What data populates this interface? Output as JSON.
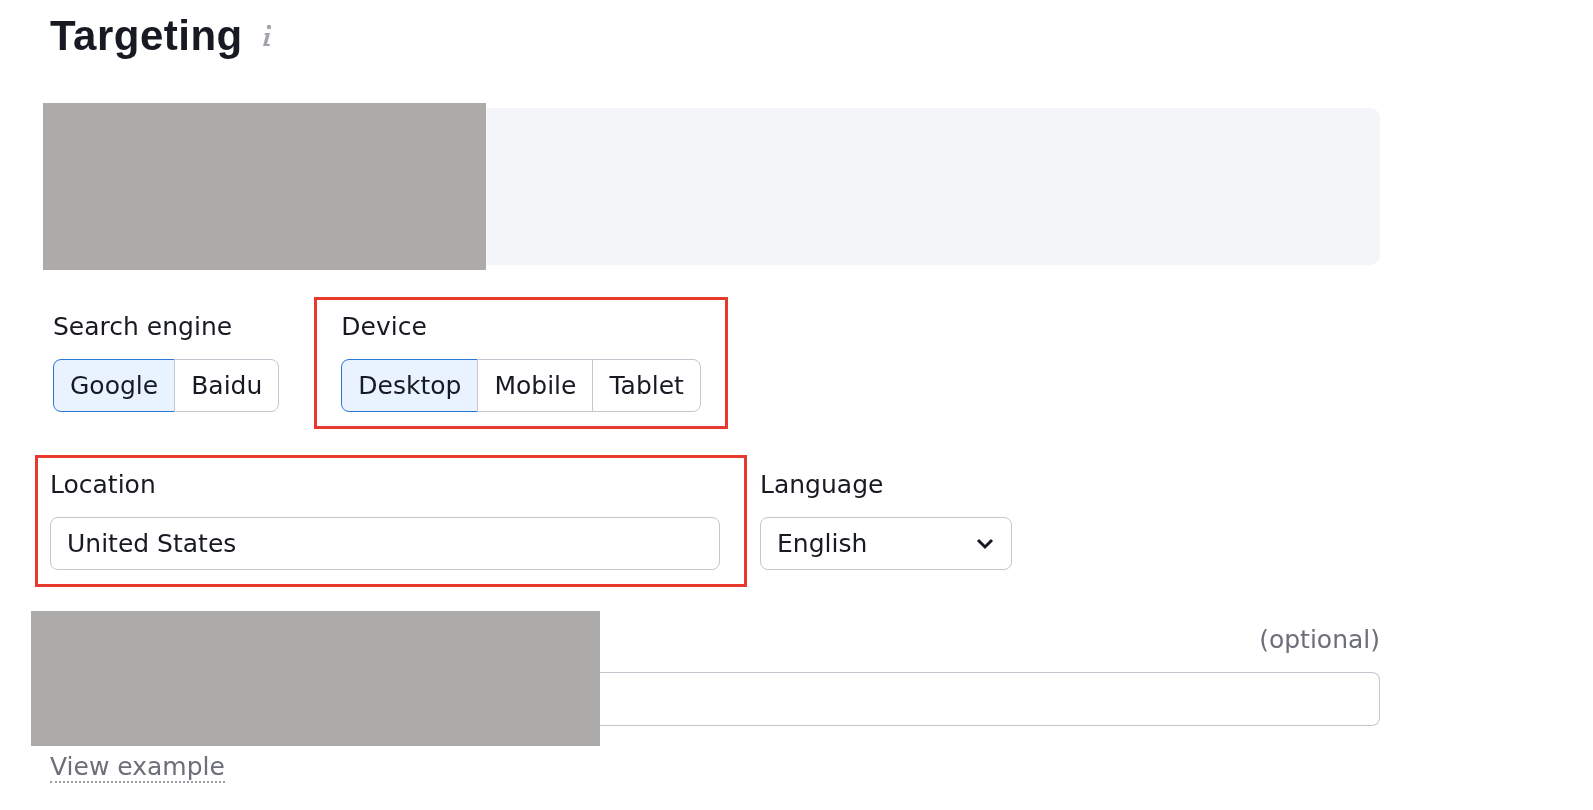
{
  "title": "Targeting",
  "search_engine": {
    "label": "Search engine",
    "highlighted": false,
    "options": [
      {
        "label": "Google",
        "selected": true
      },
      {
        "label": "Baidu",
        "selected": false
      }
    ]
  },
  "device": {
    "label": "Device",
    "highlighted": true,
    "options": [
      {
        "label": "Desktop",
        "selected": true
      },
      {
        "label": "Mobile",
        "selected": false
      },
      {
        "label": "Tablet",
        "selected": false
      }
    ]
  },
  "location": {
    "label": "Location",
    "value": "United States",
    "highlighted": true
  },
  "language": {
    "label": "Language",
    "value": "English"
  },
  "extra_field": {
    "note": "(optional)"
  },
  "view_example": "View example"
}
